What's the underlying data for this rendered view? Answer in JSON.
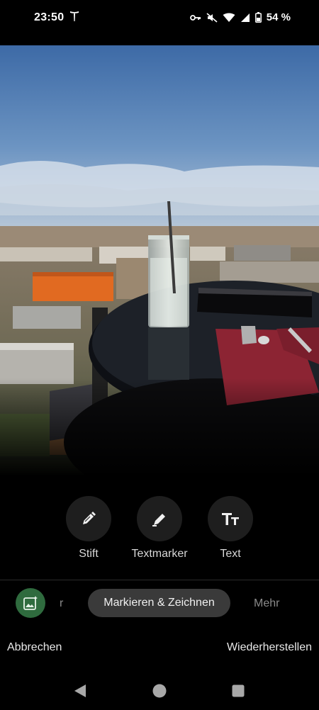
{
  "status_bar": {
    "time": "23:50",
    "battery_text": "54 %",
    "icons": [
      "tesla-icon",
      "key-icon",
      "mute-icon",
      "wifi-icon",
      "signal-icon",
      "battery-icon"
    ]
  },
  "photo": {
    "description_icon": "photo-preview"
  },
  "tools": [
    {
      "label": "Stift",
      "icon": "pen-icon"
    },
    {
      "label": "Textmarker",
      "icon": "highlighter-icon"
    },
    {
      "label": "Text",
      "icon": "text-icon"
    }
  ],
  "modes": {
    "left_label": "r",
    "active": "Markieren & Zeichnen",
    "more": "Mehr"
  },
  "actions": {
    "cancel": "Abbrechen",
    "restore": "Wiederherstellen"
  },
  "colors": {
    "accent_green": "#2f6b3e",
    "chip_bg": "#3a3a3a"
  }
}
